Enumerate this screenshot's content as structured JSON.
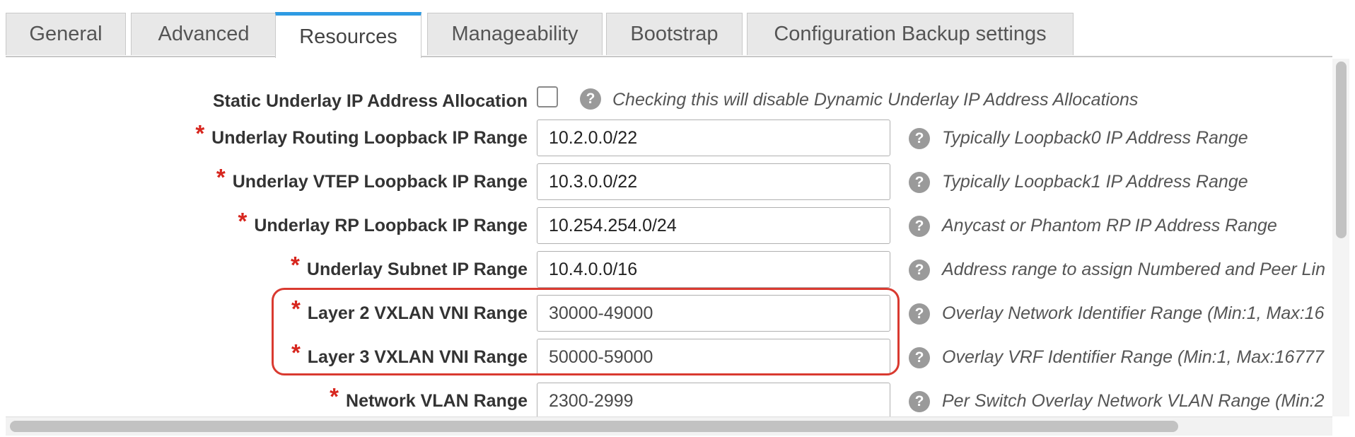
{
  "tabs": [
    {
      "label": "General"
    },
    {
      "label": "Advanced"
    },
    {
      "label": "Resources",
      "active": true
    },
    {
      "label": "Manageability"
    },
    {
      "label": "Bootstrap"
    },
    {
      "label": "Configuration Backup settings"
    }
  ],
  "form": {
    "static_underlay": {
      "label": "Static Underlay IP Address Allocation",
      "checked": false,
      "hint": "Checking this will disable Dynamic Underlay IP Address Allocations"
    },
    "fields": [
      {
        "label": "Underlay Routing Loopback IP Range",
        "required": true,
        "value": "10.2.0.0/22",
        "hint": "Typically Loopback0 IP Address Range"
      },
      {
        "label": "Underlay VTEP Loopback IP Range",
        "required": true,
        "value": "10.3.0.0/22",
        "hint": "Typically Loopback1 IP Address Range"
      },
      {
        "label": "Underlay RP Loopback IP Range",
        "required": true,
        "value": "10.254.254.0/24",
        "hint": "Anycast or Phantom RP IP Address Range"
      },
      {
        "label": "Underlay Subnet IP Range",
        "required": true,
        "value": "10.4.0.0/16",
        "hint": "Address range to assign Numbered and Peer Lin"
      },
      {
        "label": "Layer 2 VXLAN VNI Range",
        "required": true,
        "value": "30000-49000",
        "hint": "Overlay Network Identifier Range (Min:1, Max:16"
      },
      {
        "label": "Layer 3 VXLAN VNI Range",
        "required": true,
        "value": "50000-59000",
        "hint": "Overlay VRF Identifier Range (Min:1, Max:16777"
      },
      {
        "label": "Network VLAN Range",
        "required": true,
        "value": "2300-2999",
        "hint": "Per Switch Overlay Network VLAN Range (Min:2"
      }
    ],
    "required_mark": "*",
    "help_glyph": "?"
  },
  "colors": {
    "accent": "#2e9be3",
    "required": "#d7261e",
    "highlight": "#d93a30"
  }
}
